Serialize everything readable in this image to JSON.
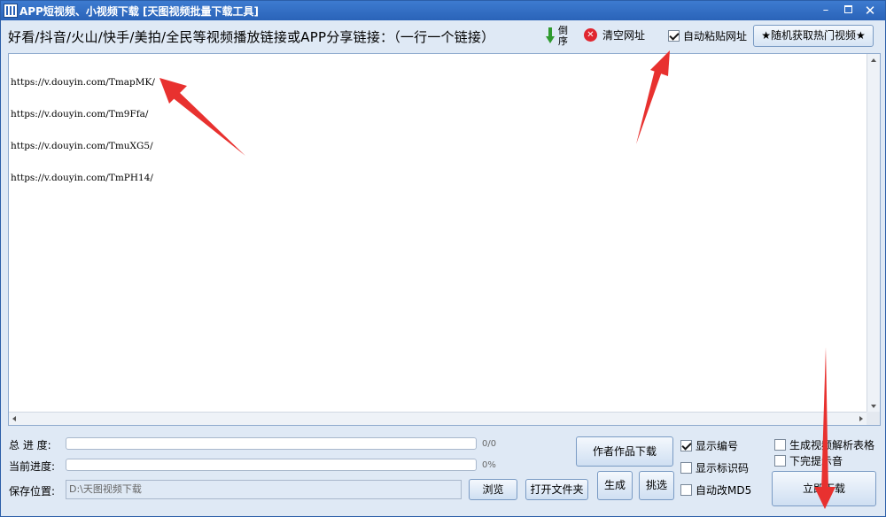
{
  "window": {
    "title": "APP短视频、小视频下载 [天图视频批量下载工具]",
    "controls": {
      "minimize": "–",
      "close": "✕"
    }
  },
  "toolbar": {
    "hint": "好看/抖音/火山/快手/美拍/全民等视频播放链接或APP分享链接：（一行一个链接）",
    "reverse_label": "倒序",
    "clear_label": "清空网址",
    "autopaste_label": "自动粘贴网址",
    "autopaste_checked": true,
    "hot_label": "★随机获取热门视频★"
  },
  "urls": [
    "https://v.douyin.com/TmapMK/",
    "https://v.douyin.com/Tm9Ffa/",
    "https://v.douyin.com/TmuXG5/",
    "https://v.douyin.com/TmPH14/"
  ],
  "progress": {
    "total_label": "总 进 度:",
    "total_text": "0/0",
    "total_fraction": 0,
    "current_label": "当前进度:",
    "current_text": "0%",
    "current_fraction": 0
  },
  "save": {
    "label": "保存位置:",
    "path": "D:\\天图视频下载",
    "browse_label": "浏览",
    "open_folder_label": "打开文件夹"
  },
  "actions": {
    "author_works_label": "作者作品下载",
    "generate_label": "生成",
    "pick_label": "挑选",
    "download_label": "立即下载"
  },
  "options": {
    "show_number": {
      "label": "显示编号",
      "checked": true
    },
    "show_id": {
      "label": "显示标识码",
      "checked": false
    },
    "auto_md5": {
      "label": "自动改MD5",
      "checked": false
    },
    "gen_table": {
      "label": "生成视频解析表格",
      "checked": false
    },
    "sound_done": {
      "label": "下完提示音",
      "checked": false
    }
  },
  "colors": {
    "titlebar": "#2a63b8",
    "window_bg": "#dfe9f5",
    "annotation_arrow": "#e8312f"
  }
}
